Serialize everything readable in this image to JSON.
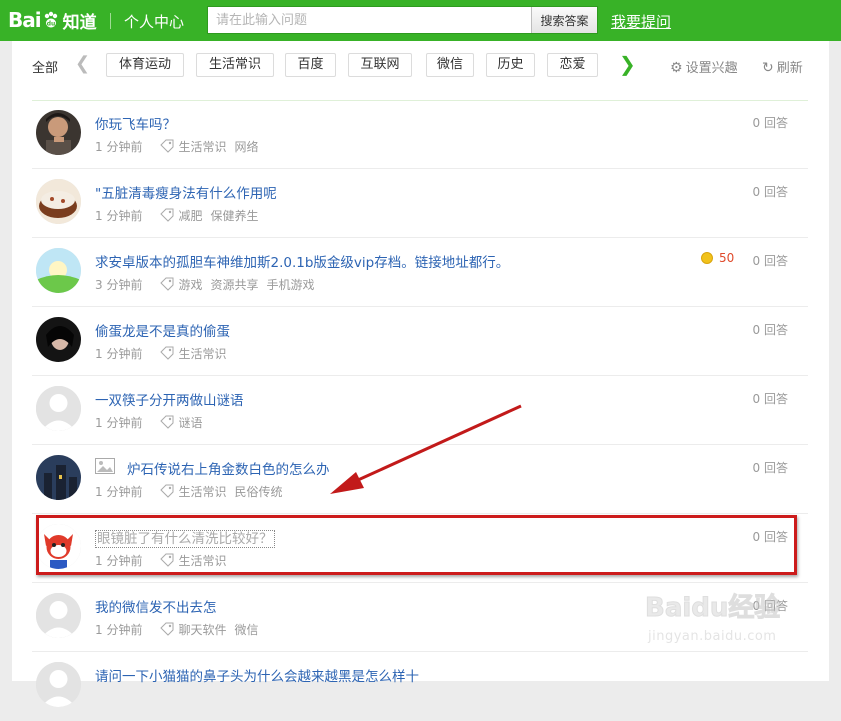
{
  "header": {
    "logo_bai": "Bai",
    "logo_du": "du",
    "logo_zhidao": "知道",
    "user_center": "个人中心",
    "search_placeholder": "请在此输入问题",
    "search_button": "搜索答案",
    "ask_button": "我要提问"
  },
  "tagbar": {
    "all_label": "全部",
    "prev_icon": "chevron-left-icon",
    "next_icon": "chevron-right-icon",
    "tags": [
      "体育运动",
      "生活常识",
      "百度",
      "互联网",
      "微信",
      "历史",
      "恋爱"
    ],
    "settings_label": "设置兴趣",
    "refresh_label": "刷新"
  },
  "questions": [
    {
      "title": "你玩飞车吗？",
      "time": "1 分钟前",
      "tags": [
        "生活常识",
        "网络"
      ],
      "answers": "0 回答",
      "avatar": "man-portrait"
    },
    {
      "title": "\"五脏清毒瘦身法有什么作用呢",
      "time": "1 分钟前",
      "tags": [
        "减肥",
        "保健养生"
      ],
      "answers": "0 回答",
      "avatar": "cake"
    },
    {
      "title": "求安卓版本的孤胆车神维加斯2.0.1b版金级vip存档。链接地址都行。",
      "time": "3 分钟前",
      "tags": [
        "游戏",
        "资源共享",
        "手机游戏"
      ],
      "answers": "0 回答",
      "reward": "50",
      "avatar": "sunrise"
    },
    {
      "title": "偷蛋龙是不是真的偷蛋",
      "time": "1 分钟前",
      "tags": [
        "生活常识"
      ],
      "answers": "0 回答",
      "avatar": "girl-portrait"
    },
    {
      "title": "一双筷子分开两做山谜语",
      "time": "1 分钟前",
      "tags": [
        "谜语"
      ],
      "answers": "0 回答",
      "avatar": "default-user"
    },
    {
      "title": "炉石传说右上角金数白色的怎么办",
      "time": "1 分钟前",
      "tags": [
        "生活常识",
        "民俗传统"
      ],
      "answers": "0 回答",
      "avatar": "night-castle",
      "has_image": true
    },
    {
      "title": "眼镜脏了有什么清洗比较好？",
      "time": "1 分钟前",
      "tags": [
        "生活常识"
      ],
      "answers": "0 回答",
      "avatar": "cartoon-fox"
    },
    {
      "title": "我的微信发不出去怎",
      "time": "1 分钟前",
      "tags": [
        "聊天软件",
        "微信"
      ],
      "answers": "0 回答",
      "avatar": "default-user"
    },
    {
      "title": "请问一下小猫猫的鼻子头为什么会越来越黑是怎么样十",
      "time": "",
      "tags": [],
      "answers": "",
      "avatar": "default-user"
    }
  ],
  "watermark": {
    "line1": "Baidu经验",
    "line2": "jingyan.baidu.com"
  }
}
